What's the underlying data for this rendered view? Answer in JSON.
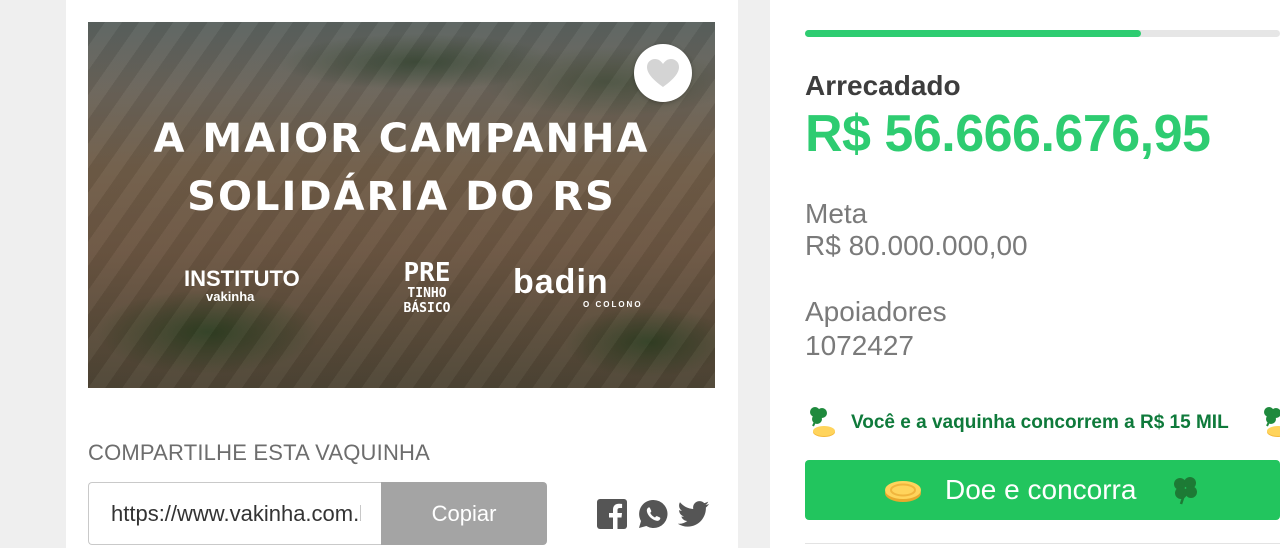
{
  "banner": {
    "title_line1": "A MAIOR CAMPANHA",
    "title_line2": "SOLIDÁRIA DO RS",
    "logo_instituto_main": "INSTITUTO",
    "logo_instituto_sub": "vakinha",
    "logo_pre_main": "PRE",
    "logo_pre_sub1": "TINHO",
    "logo_pre_sub2": "BÁSICO",
    "logo_badin_main": "badin",
    "logo_badin_sub": "O COLONO"
  },
  "share": {
    "title": "COMPARTILHE ESTA VAQUINHA",
    "url_value": "https://www.vakinha.com.br/",
    "copy_label": "Copiar",
    "icons": [
      "facebook-icon",
      "whatsapp-icon",
      "twitter-icon"
    ]
  },
  "stats": {
    "progress_fraction": 0.7083,
    "raised_label": "Arrecadado",
    "raised_value": "R$ 56.666.676,95",
    "goal_label": "Meta",
    "goal_value": "R$ 80.000.000,00",
    "supporters_label": "Apoiadores",
    "supporters_value": "1072427"
  },
  "promo": {
    "text": "Você e a vaquinha concorrem a R$ 15 MIL"
  },
  "donate": {
    "label": "Doe e concorra"
  },
  "colors": {
    "accent_green": "#2ecc71",
    "button_green": "#22c55e",
    "promo_text": "#0f7a3b",
    "copy_button": "#a4a4a4"
  }
}
